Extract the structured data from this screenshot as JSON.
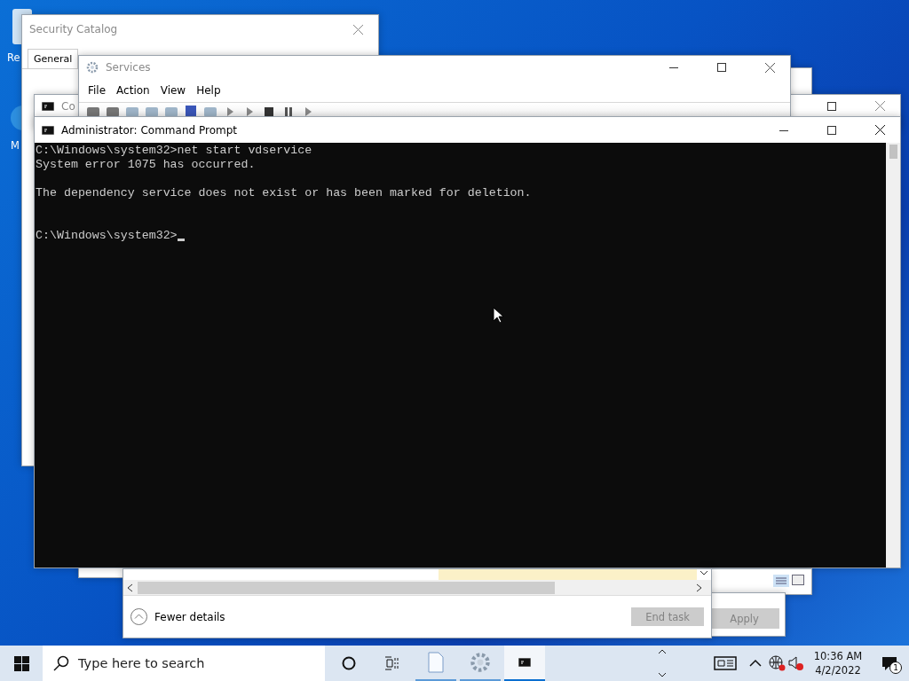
{
  "desktop_icons": [
    {
      "label": "Re"
    },
    {
      "label": "M"
    }
  ],
  "security_catalog": {
    "title": "Security Catalog",
    "tabs": [
      {
        "label": "General",
        "selected": true
      }
    ]
  },
  "background_console": {
    "title": "Co"
  },
  "services": {
    "title": "Services",
    "menu": [
      "File",
      "Action",
      "View",
      "Help"
    ]
  },
  "command_prompt": {
    "title": "Administrator: Command Prompt",
    "lines": [
      {
        "kind": "text",
        "text": "C:\\Windows\\system32>net start vdservice"
      },
      {
        "kind": "text",
        "text": "System error 1075 has occurred."
      },
      {
        "kind": "blank"
      },
      {
        "kind": "text",
        "text": "The dependency service does not exist or has been marked for deletion."
      },
      {
        "kind": "blank"
      },
      {
        "kind": "blank"
      },
      {
        "kind": "text",
        "text": "C:\\Windows\\system32>"
      }
    ],
    "cursor": true
  },
  "task_manager": {
    "fewer_details": "Fewer details",
    "end_task": {
      "label": "End task",
      "disabled": true
    }
  },
  "properties": {
    "apply": {
      "label": "Apply",
      "disabled": true
    }
  },
  "taskbar": {
    "search_placeholder": "Type here to search",
    "apps": [
      {
        "kind": "file",
        "selected": false
      },
      {
        "kind": "gear",
        "selected": false
      },
      {
        "kind": "console",
        "selected": true
      }
    ],
    "time": "10:36 AM",
    "date": "4/2/2022",
    "notifications": "1"
  }
}
